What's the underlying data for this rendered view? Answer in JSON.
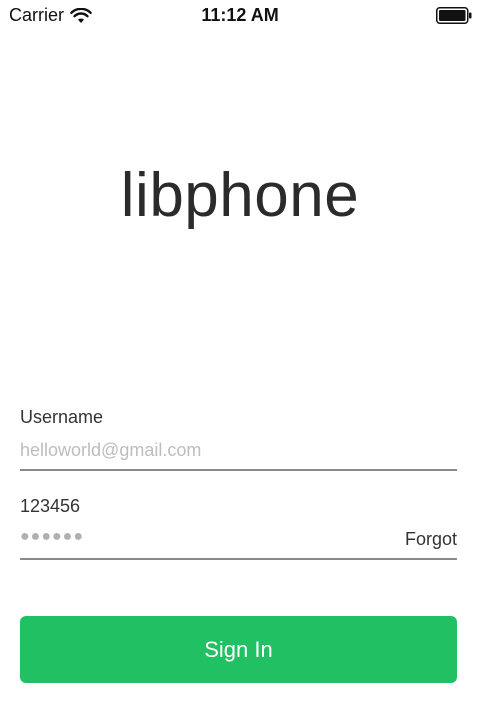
{
  "status_bar": {
    "carrier": "Carrier",
    "time": "11:12 AM",
    "wifi_icon": "wifi-icon",
    "battery_icon": "battery-icon"
  },
  "app": {
    "logo_text": "libphone"
  },
  "form": {
    "username": {
      "label": "Username",
      "placeholder": "helloworld@gmail.com",
      "value": ""
    },
    "password": {
      "label": "123456",
      "masked_value": "●●●●●●",
      "forgot_label": "Forgot"
    },
    "submit_label": "Sign In"
  },
  "colors": {
    "accent": "#21c063",
    "text": "#333333",
    "placeholder": "#bdbdbd",
    "underline": "#8a8a8a"
  }
}
